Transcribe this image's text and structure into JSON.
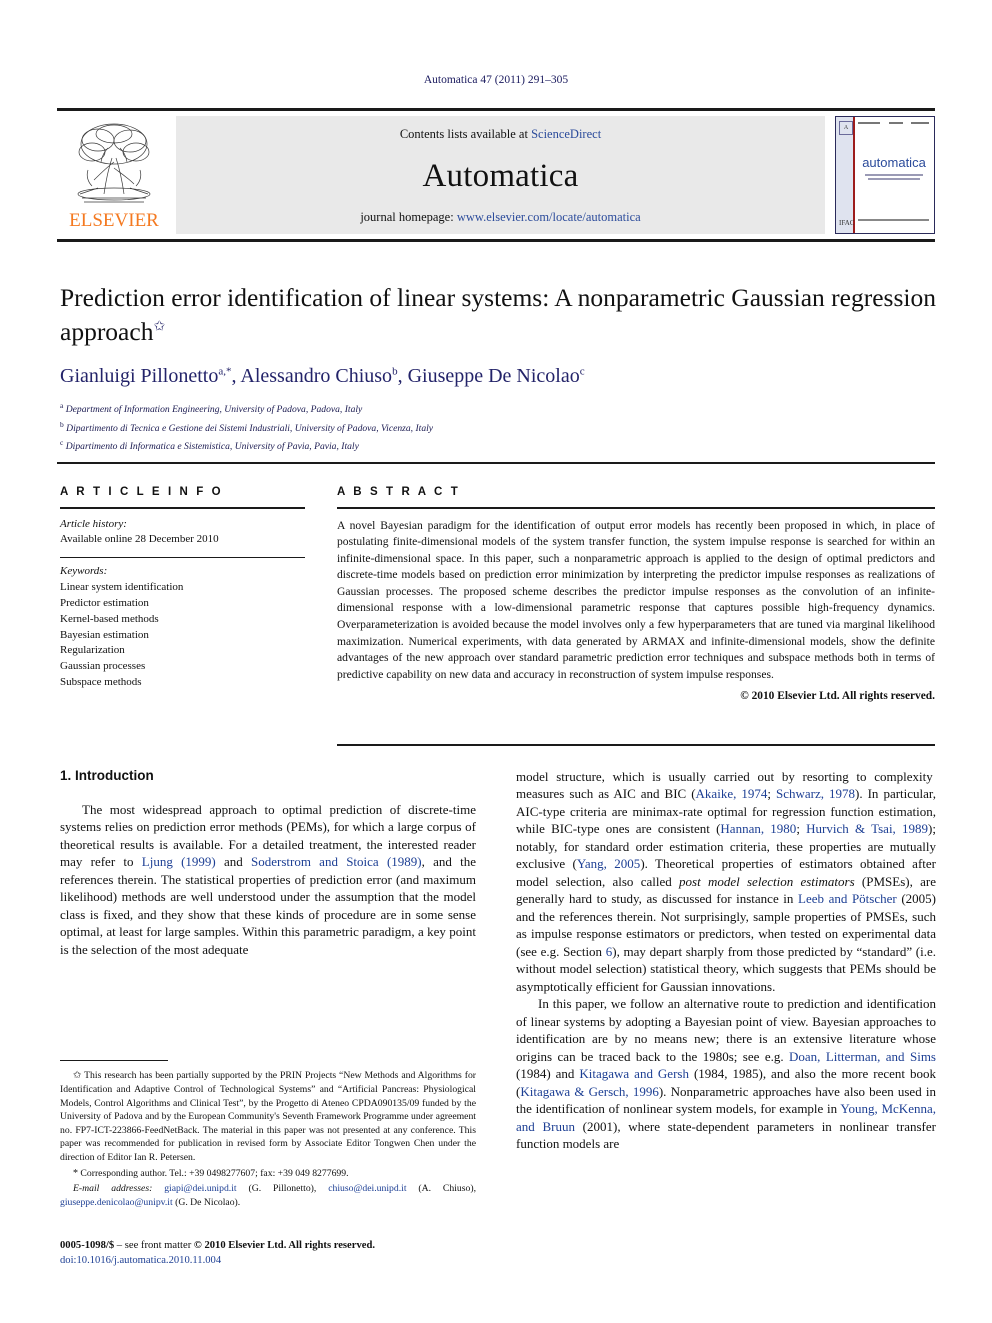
{
  "running_head": "Automatica 47 (2011) 291–305",
  "header": {
    "contents_prefix": "Contents lists available at ",
    "contents_link": "ScienceDirect",
    "journal_name": "Automatica",
    "homepage_prefix": "journal homepage: ",
    "homepage_url": "www.elsevier.com/locate/automatica",
    "publisher": "ELSEVIER",
    "cover": {
      "title": "automatica",
      "badge": "IFAC"
    }
  },
  "title": {
    "text": "Prediction error identification of linear systems: A nonparametric Gaussian regression approach",
    "footnote_marker": "✩"
  },
  "authors": {
    "line": "Gianluigi Pillonetto a,*, Alessandro Chiuso b, Giuseppe De Nicolao c",
    "list": [
      {
        "name": "Gianluigi Pillonetto",
        "sup": "a,*"
      },
      {
        "name": "Alessandro Chiuso",
        "sup": "b"
      },
      {
        "name": "Giuseppe De Nicolao",
        "sup": "c"
      }
    ],
    "affiliations": [
      {
        "sup": "a",
        "text": "Department of Information Engineering, University of Padova, Padova, Italy"
      },
      {
        "sup": "b",
        "text": "Dipartimento di Tecnica e Gestione dei Sistemi Industriali, University of Padova, Vicenza, Italy"
      },
      {
        "sup": "c",
        "text": "Dipartimento di Informatica e Sistemistica, University of Pavia, Pavia, Italy"
      }
    ]
  },
  "article_info": {
    "heading": "A R T I C L E    I N F O",
    "history_label": "Article history:",
    "history_value": "Available online 28 December 2010",
    "keywords_label": "Keywords:",
    "keywords": [
      "Linear system identification",
      "Predictor estimation",
      "Kernel-based methods",
      "Bayesian estimation",
      "Regularization",
      "Gaussian processes",
      "Subspace methods"
    ]
  },
  "abstract": {
    "heading": "A B S T R A C T",
    "text": "A novel Bayesian paradigm for the identification of output error models has recently been proposed in which, in place of postulating finite-dimensional models of the system transfer function, the system impulse response is searched for within an infinite-dimensional space. In this paper, such a nonparametric approach is applied to the design of optimal predictors and discrete-time models based on prediction error minimization by interpreting the predictor impulse responses as realizations of Gaussian processes. The proposed scheme describes the predictor impulse responses as the convolution of an infinite-dimensional response with a low-dimensional parametric response that captures possible high-frequency dynamics. Overparameterization is avoided because the model involves only a few hyperparameters that are tuned via marginal likelihood maximization. Numerical experiments, with data generated by ARMAX and infinite-dimensional models, show the definite advantages of the new approach over standard parametric prediction error techniques and subspace methods both in terms of predictive capability on new data and accuracy in reconstruction of system impulse responses.",
    "copyright": "© 2010 Elsevier Ltd. All rights reserved."
  },
  "body": {
    "section_heading": "1. Introduction",
    "left_paragraph_1": "The most widespread approach to optimal prediction of discrete-time systems relies on prediction error methods (PEMs), for which a large corpus of theoretical results is available. For a detailed treatment, the interested reader may refer to Ljung (1999) and Soderstrom and Stoica (1989), and the references therein. The statistical properties of prediction error (and maximum likelihood) methods are well understood under the assumption that the model class is fixed, and they show that these kinds of procedure are in some sense optimal, at least for large samples. Within this parametric paradigm, a key point is the selection of the most adequate",
    "right_paragraph_1": "model structure, which is usually carried out by resorting to complexity  measures such as AIC and BIC (Akaike, 1974; Schwarz, 1978). In particular, AIC-type criteria are minimax-rate optimal for regression function estimation, while BIC-type ones are consistent (Hannan, 1980; Hurvich & Tsai, 1989); notably, for standard order estimation criteria, these properties are mutually exclusive (Yang, 2005). Theoretical properties of estimators obtained after model selection, also called post model selection estimators (PMSEs), are generally hard to study, as discussed for instance in Leeb and Pötscher (2005) and the references therein. Not surprisingly, sample properties of PMSEs, such as impulse response estimators or predictors, when tested on experimental data (see e.g. Section 6), may depart sharply from those predicted by “standard” (i.e. without model selection) statistical theory, which suggests that PEMs should be asymptotically efficient for Gaussian innovations.",
    "right_paragraph_2": "In this paper, we follow an alternative route to prediction and identification of linear systems by adopting a Bayesian point of view. Bayesian approaches to identification are by no means new; there is an extensive literature whose origins can be traced back to the 1980s; see e.g. Doan, Litterman, and Sims (1984) and Kitagawa and Gersh (1984, 1985), and also the more recent book (Kitagawa & Gersch, 1996). Nonparametric approaches have also been used in the identification of nonlinear system models, for example in Young, McKenna, and Bruun (2001), where state-dependent parameters in nonlinear transfer function models are"
  },
  "footnotes": {
    "funding_marker": "✩",
    "funding": "This research has been partially supported by the PRIN Projects “New Methods and Algorithms for Identification and Adaptive Control of Technological Systems” and “Artificial Pancreas: Physiological Models, Control Algorithms and Clinical Test”, by the Progetto di Ateneo CPDA090135/09 funded by the University of Padova and by the European Community's Seventh Framework Programme under agreement no. FP7-ICT-223866-FeedNetBack. The material in this paper was not presented at any conference. This paper was recommended for publication in revised form by Associate Editor Tongwen Chen under the direction of Editor Ian R. Petersen.",
    "corresponding_marker": "*",
    "corresponding": "Corresponding author. Tel.: +39 0498277607; fax: +39 049 8277699.",
    "email_label": "E-mail addresses:",
    "emails": [
      {
        "address": "giapi@dei.unipd.it",
        "owner": "(G. Pillonetto)"
      },
      {
        "address": "chiuso@dei.unipd.it",
        "owner": "(A. Chiuso)"
      },
      {
        "address": "giuseppe.denicolao@unipv.it",
        "owner": "(G. De Nicolao)"
      }
    ]
  },
  "imprint": {
    "issn_line": "0005-1098/$ – see front matter © 2010 Elsevier Ltd. All rights reserved.",
    "issn_prefix": "0005-1098/$",
    "issn_rest": " – see front matter ",
    "issn_copy": "© 2010 Elsevier Ltd. All rights reserved.",
    "doi": "doi:10.1016/j.automatica.2010.11.004"
  }
}
